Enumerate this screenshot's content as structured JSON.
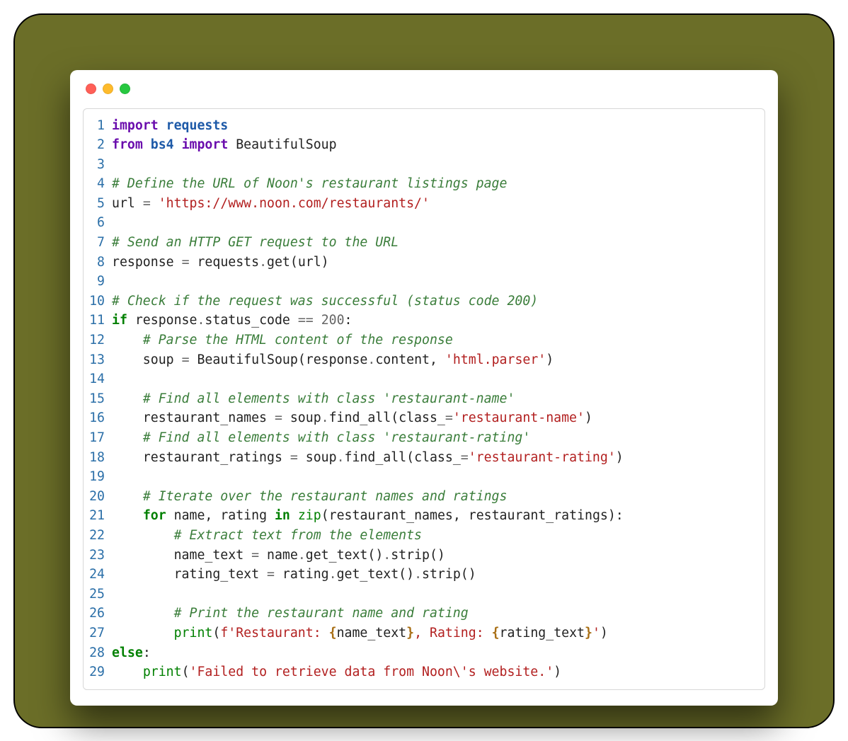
{
  "window": {
    "dots": [
      "red",
      "yellow",
      "green"
    ]
  },
  "code": {
    "lines": [
      {
        "n": 1,
        "tokens": [
          {
            "c": "tok-imp",
            "t": "import"
          },
          {
            "c": "",
            "t": " "
          },
          {
            "c": "tok-nn",
            "t": "requests"
          }
        ]
      },
      {
        "n": 2,
        "tokens": [
          {
            "c": "tok-imp",
            "t": "from"
          },
          {
            "c": "",
            "t": " "
          },
          {
            "c": "tok-nn",
            "t": "bs4"
          },
          {
            "c": "",
            "t": " "
          },
          {
            "c": "tok-imp",
            "t": "import"
          },
          {
            "c": "",
            "t": " BeautifulSoup"
          }
        ]
      },
      {
        "n": 3,
        "tokens": []
      },
      {
        "n": 4,
        "tokens": [
          {
            "c": "tok-cmt",
            "t": "# Define the URL of Noon's restaurant listings page"
          }
        ]
      },
      {
        "n": 5,
        "tokens": [
          {
            "c": "",
            "t": "url "
          },
          {
            "c": "tok-op",
            "t": "="
          },
          {
            "c": "",
            "t": " "
          },
          {
            "c": "tok-str",
            "t": "'https://www.noon.com/restaurants/'"
          }
        ]
      },
      {
        "n": 6,
        "tokens": []
      },
      {
        "n": 7,
        "tokens": [
          {
            "c": "tok-cmt",
            "t": "# Send an HTTP GET request to the URL"
          }
        ]
      },
      {
        "n": 8,
        "tokens": [
          {
            "c": "",
            "t": "response "
          },
          {
            "c": "tok-op",
            "t": "="
          },
          {
            "c": "",
            "t": " requests"
          },
          {
            "c": "tok-op",
            "t": "."
          },
          {
            "c": "",
            "t": "get(url)"
          }
        ]
      },
      {
        "n": 9,
        "tokens": []
      },
      {
        "n": 10,
        "tokens": [
          {
            "c": "tok-cmt",
            "t": "# Check if the request was successful (status code 200)"
          }
        ]
      },
      {
        "n": 11,
        "tokens": [
          {
            "c": "tok-kw",
            "t": "if"
          },
          {
            "c": "",
            "t": " response"
          },
          {
            "c": "tok-op",
            "t": "."
          },
          {
            "c": "",
            "t": "status_code "
          },
          {
            "c": "tok-op",
            "t": "=="
          },
          {
            "c": "",
            "t": " "
          },
          {
            "c": "tok-num",
            "t": "200"
          },
          {
            "c": "",
            "t": ":"
          }
        ]
      },
      {
        "n": 12,
        "tokens": [
          {
            "c": "",
            "t": "    "
          },
          {
            "c": "tok-cmt",
            "t": "# Parse the HTML content of the response"
          }
        ]
      },
      {
        "n": 13,
        "tokens": [
          {
            "c": "",
            "t": "    soup "
          },
          {
            "c": "tok-op",
            "t": "="
          },
          {
            "c": "",
            "t": " BeautifulSoup(response"
          },
          {
            "c": "tok-op",
            "t": "."
          },
          {
            "c": "",
            "t": "content, "
          },
          {
            "c": "tok-str",
            "t": "'html.parser'"
          },
          {
            "c": "",
            "t": ")"
          }
        ]
      },
      {
        "n": 14,
        "tokens": []
      },
      {
        "n": 15,
        "tokens": [
          {
            "c": "",
            "t": "    "
          },
          {
            "c": "tok-cmt",
            "t": "# Find all elements with class 'restaurant-name'"
          }
        ]
      },
      {
        "n": 16,
        "tokens": [
          {
            "c": "",
            "t": "    restaurant_names "
          },
          {
            "c": "tok-op",
            "t": "="
          },
          {
            "c": "",
            "t": " soup"
          },
          {
            "c": "tok-op",
            "t": "."
          },
          {
            "c": "",
            "t": "find_all(class_"
          },
          {
            "c": "tok-op",
            "t": "="
          },
          {
            "c": "tok-str",
            "t": "'restaurant-name'"
          },
          {
            "c": "",
            "t": ")"
          }
        ]
      },
      {
        "n": 17,
        "tokens": [
          {
            "c": "",
            "t": "    "
          },
          {
            "c": "tok-cmt",
            "t": "# Find all elements with class 'restaurant-rating'"
          }
        ]
      },
      {
        "n": 18,
        "tokens": [
          {
            "c": "",
            "t": "    restaurant_ratings "
          },
          {
            "c": "tok-op",
            "t": "="
          },
          {
            "c": "",
            "t": " soup"
          },
          {
            "c": "tok-op",
            "t": "."
          },
          {
            "c": "",
            "t": "find_all(class_"
          },
          {
            "c": "tok-op",
            "t": "="
          },
          {
            "c": "tok-str",
            "t": "'restaurant-rating'"
          },
          {
            "c": "",
            "t": ")"
          }
        ]
      },
      {
        "n": 19,
        "tokens": []
      },
      {
        "n": 20,
        "tokens": [
          {
            "c": "",
            "t": "    "
          },
          {
            "c": "tok-cmt",
            "t": "# Iterate over the restaurant names and ratings"
          }
        ]
      },
      {
        "n": 21,
        "tokens": [
          {
            "c": "",
            "t": "    "
          },
          {
            "c": "tok-kw",
            "t": "for"
          },
          {
            "c": "",
            "t": " name, rating "
          },
          {
            "c": "tok-kw",
            "t": "in"
          },
          {
            "c": "",
            "t": " "
          },
          {
            "c": "tok-bltn",
            "t": "zip"
          },
          {
            "c": "",
            "t": "(restaurant_names, restaurant_ratings):"
          }
        ]
      },
      {
        "n": 22,
        "tokens": [
          {
            "c": "",
            "t": "        "
          },
          {
            "c": "tok-cmt",
            "t": "# Extract text from the elements"
          }
        ]
      },
      {
        "n": 23,
        "tokens": [
          {
            "c": "",
            "t": "        name_text "
          },
          {
            "c": "tok-op",
            "t": "="
          },
          {
            "c": "",
            "t": " name"
          },
          {
            "c": "tok-op",
            "t": "."
          },
          {
            "c": "",
            "t": "get_text()"
          },
          {
            "c": "tok-op",
            "t": "."
          },
          {
            "c": "",
            "t": "strip()"
          }
        ]
      },
      {
        "n": 24,
        "tokens": [
          {
            "c": "",
            "t": "        rating_text "
          },
          {
            "c": "tok-op",
            "t": "="
          },
          {
            "c": "",
            "t": " rating"
          },
          {
            "c": "tok-op",
            "t": "."
          },
          {
            "c": "",
            "t": "get_text()"
          },
          {
            "c": "tok-op",
            "t": "."
          },
          {
            "c": "",
            "t": "strip()"
          }
        ]
      },
      {
        "n": 25,
        "tokens": []
      },
      {
        "n": 26,
        "tokens": [
          {
            "c": "",
            "t": "        "
          },
          {
            "c": "tok-cmt",
            "t": "# Print the restaurant name and rating"
          }
        ]
      },
      {
        "n": 27,
        "tokens": [
          {
            "c": "",
            "t": "        "
          },
          {
            "c": "tok-bltn",
            "t": "print"
          },
          {
            "c": "",
            "t": "("
          },
          {
            "c": "tok-afx",
            "t": "f'Restaurant: "
          },
          {
            "c": "tok-si",
            "t": "{"
          },
          {
            "c": "",
            "t": "name_text"
          },
          {
            "c": "tok-si",
            "t": "}"
          },
          {
            "c": "tok-afx",
            "t": ", Rating: "
          },
          {
            "c": "tok-si",
            "t": "{"
          },
          {
            "c": "",
            "t": "rating_text"
          },
          {
            "c": "tok-si",
            "t": "}"
          },
          {
            "c": "tok-afx",
            "t": "'"
          },
          {
            "c": "",
            "t": ")"
          }
        ]
      },
      {
        "n": 28,
        "tokens": [
          {
            "c": "tok-kw",
            "t": "else"
          },
          {
            "c": "",
            "t": ":"
          }
        ]
      },
      {
        "n": 29,
        "tokens": [
          {
            "c": "",
            "t": "    "
          },
          {
            "c": "tok-bltn",
            "t": "print"
          },
          {
            "c": "",
            "t": "("
          },
          {
            "c": "tok-str",
            "t": "'Failed to retrieve data from Noon\\'s website.'"
          },
          {
            "c": "",
            "t": ")"
          }
        ]
      }
    ]
  }
}
